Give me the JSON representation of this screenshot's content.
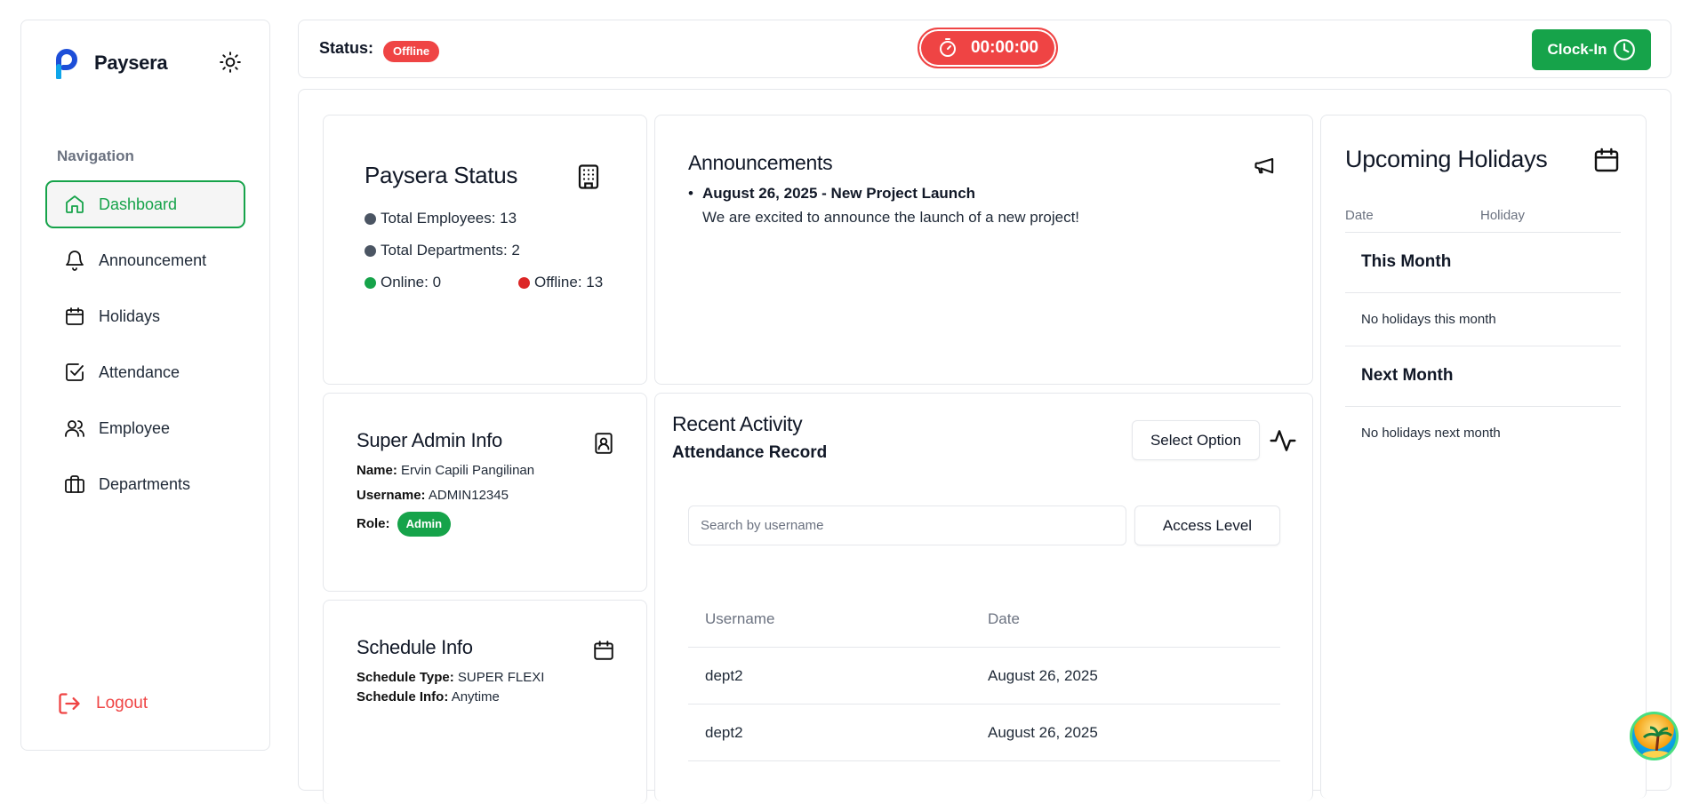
{
  "brand": {
    "name": "Paysera"
  },
  "sidebar": {
    "heading": "Navigation",
    "items": [
      {
        "label": "Dashboard",
        "icon": "home-icon",
        "active": true
      },
      {
        "label": "Announcement",
        "icon": "bell-icon",
        "active": false
      },
      {
        "label": "Holidays",
        "icon": "calendar-icon",
        "active": false
      },
      {
        "label": "Attendance",
        "icon": "checkbox-icon",
        "active": false
      },
      {
        "label": "Employee",
        "icon": "users-icon",
        "active": false
      },
      {
        "label": "Departments",
        "icon": "briefcase-icon",
        "active": false
      }
    ],
    "logout": "Logout"
  },
  "topbar": {
    "status_label": "Status:",
    "status_value": "Offline",
    "timer": "00:00:00",
    "clockin_label": "Clock-In"
  },
  "status_card": {
    "title": "Paysera Status",
    "total_employees": "Total Employees: 13",
    "total_departments": "Total Departments: 2",
    "online": "Online: 0",
    "offline": "Offline: 13"
  },
  "announcements": {
    "title": "Announcements",
    "items": [
      {
        "title": "August 26, 2025 - New Project Launch",
        "body": "We are excited to announce the launch of a new project!"
      }
    ]
  },
  "holidays": {
    "title": "Upcoming Holidays",
    "col_date": "Date",
    "col_holiday": "Holiday",
    "this_month_title": "This Month",
    "this_month_empty": "No holidays this month",
    "next_month_title": "Next Month",
    "next_month_empty": "No holidays next month"
  },
  "admin": {
    "title": "Super Admin Info",
    "name_label": "Name:",
    "name": "Ervin Capili Pangilinan",
    "username_label": "Username:",
    "username": "ADMIN12345",
    "role_label": "Role:",
    "role": "Admin"
  },
  "schedule": {
    "title": "Schedule Info",
    "type_label": "Schedule Type:",
    "type": "SUPER FLEXI",
    "info_label": "Schedule Info:",
    "info": "Anytime"
  },
  "activity": {
    "title": "Recent Activity",
    "subtitle": "Attendance Record",
    "select_label": "Select Option",
    "search_placeholder": "Search by username",
    "access_label": "Access Level",
    "columns": [
      "Username",
      "Date"
    ],
    "rows": [
      [
        "dept2",
        "August 26, 2025"
      ],
      [
        "dept2",
        "August 26, 2025"
      ]
    ]
  },
  "colors": {
    "accent": "#16a34a",
    "danger": "#ef4444",
    "neutral_dot": "#4b5563"
  }
}
